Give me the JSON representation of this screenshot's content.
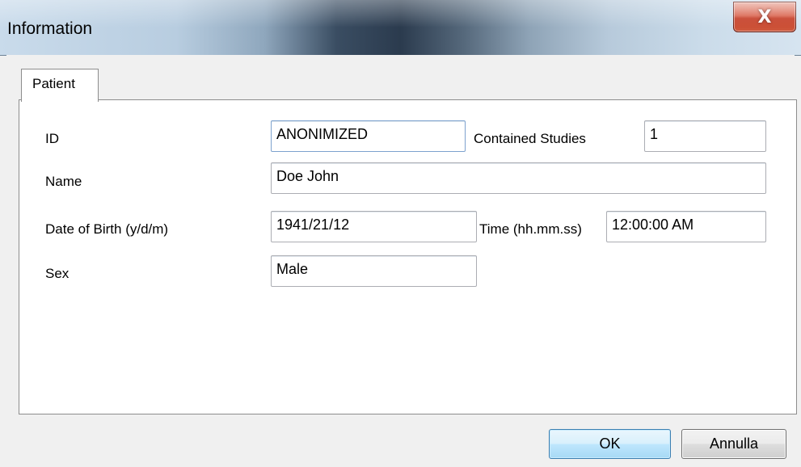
{
  "window": {
    "title": "Information",
    "close_glyph": "X"
  },
  "tabs": [
    {
      "label": "Patient",
      "active": true
    }
  ],
  "patient": {
    "id_label": "ID",
    "id_value": "ANONIMIZED",
    "contained_studies_label": "Contained Studies",
    "contained_studies_value": "1",
    "name_label": "Name",
    "name_value": "Doe John",
    "dob_label": "Date of Birth (y/d/m)",
    "dob_value": "1941/21/12",
    "time_label": "Time (hh.mm.ss)",
    "time_value": "12:00:00 AM",
    "sex_label": "Sex",
    "sex_value": "Male"
  },
  "buttons": {
    "ok": "OK",
    "cancel": "Annulla"
  },
  "colors": {
    "close_button": "#c43a23",
    "default_button_border": "#3c7fb1",
    "focused_field_border": "#7da2ce"
  }
}
